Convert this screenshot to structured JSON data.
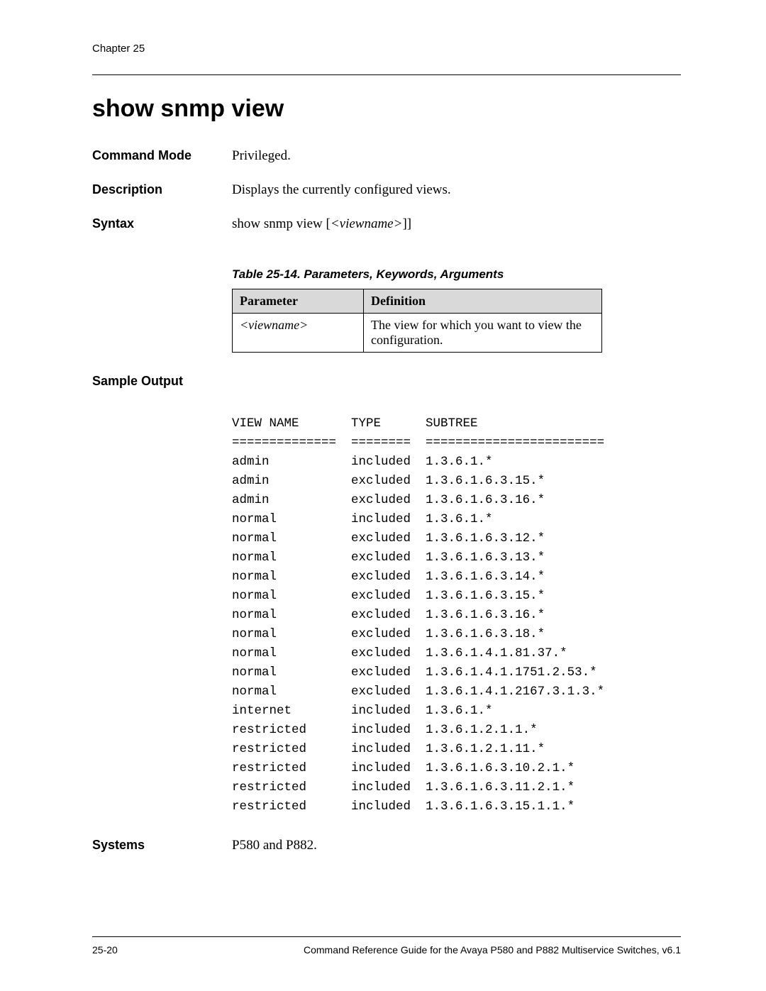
{
  "chapter": "Chapter 25",
  "title": "show snmp view",
  "fields": {
    "command_mode": {
      "label": "Command Mode",
      "value": "Privileged."
    },
    "description": {
      "label": "Description",
      "value": "Displays the currently configured views."
    },
    "syntax": {
      "label": "Syntax",
      "prefix": "show snmp view [",
      "arg": "<viewname>",
      "suffix": "]]"
    },
    "sample_output": {
      "label": "Sample Output"
    },
    "systems": {
      "label": "Systems",
      "value": "P580 and P882."
    }
  },
  "table": {
    "caption": "Table 25-14.  Parameters, Keywords, Arguments",
    "headers": {
      "parameter": "Parameter",
      "definition": "Definition"
    },
    "rows": [
      {
        "parameter": "<viewname>",
        "definition": "The view for which you want to view the configuration."
      }
    ]
  },
  "output_text": "VIEW NAME       TYPE      SUBTREE\n==============  ========  ========================\nadmin           included  1.3.6.1.*\nadmin           excluded  1.3.6.1.6.3.15.*\nadmin           excluded  1.3.6.1.6.3.16.*\nnormal          included  1.3.6.1.*\nnormal          excluded  1.3.6.1.6.3.12.*\nnormal          excluded  1.3.6.1.6.3.13.*\nnormal          excluded  1.3.6.1.6.3.14.*\nnormal          excluded  1.3.6.1.6.3.15.*\nnormal          excluded  1.3.6.1.6.3.16.*\nnormal          excluded  1.3.6.1.6.3.18.*\nnormal          excluded  1.3.6.1.4.1.81.37.*\nnormal          excluded  1.3.6.1.4.1.1751.2.53.*\nnormal          excluded  1.3.6.1.4.1.2167.3.1.3.*\ninternet        included  1.3.6.1.*\nrestricted      included  1.3.6.1.2.1.1.*\nrestricted      included  1.3.6.1.2.1.11.*\nrestricted      included  1.3.6.1.6.3.10.2.1.*\nrestricted      included  1.3.6.1.6.3.11.2.1.*\nrestricted      included  1.3.6.1.6.3.15.1.1.*",
  "footer": {
    "page": "25-20",
    "doc": "Command Reference Guide for the Avaya P580 and P882 Multiservice Switches, v6.1"
  }
}
